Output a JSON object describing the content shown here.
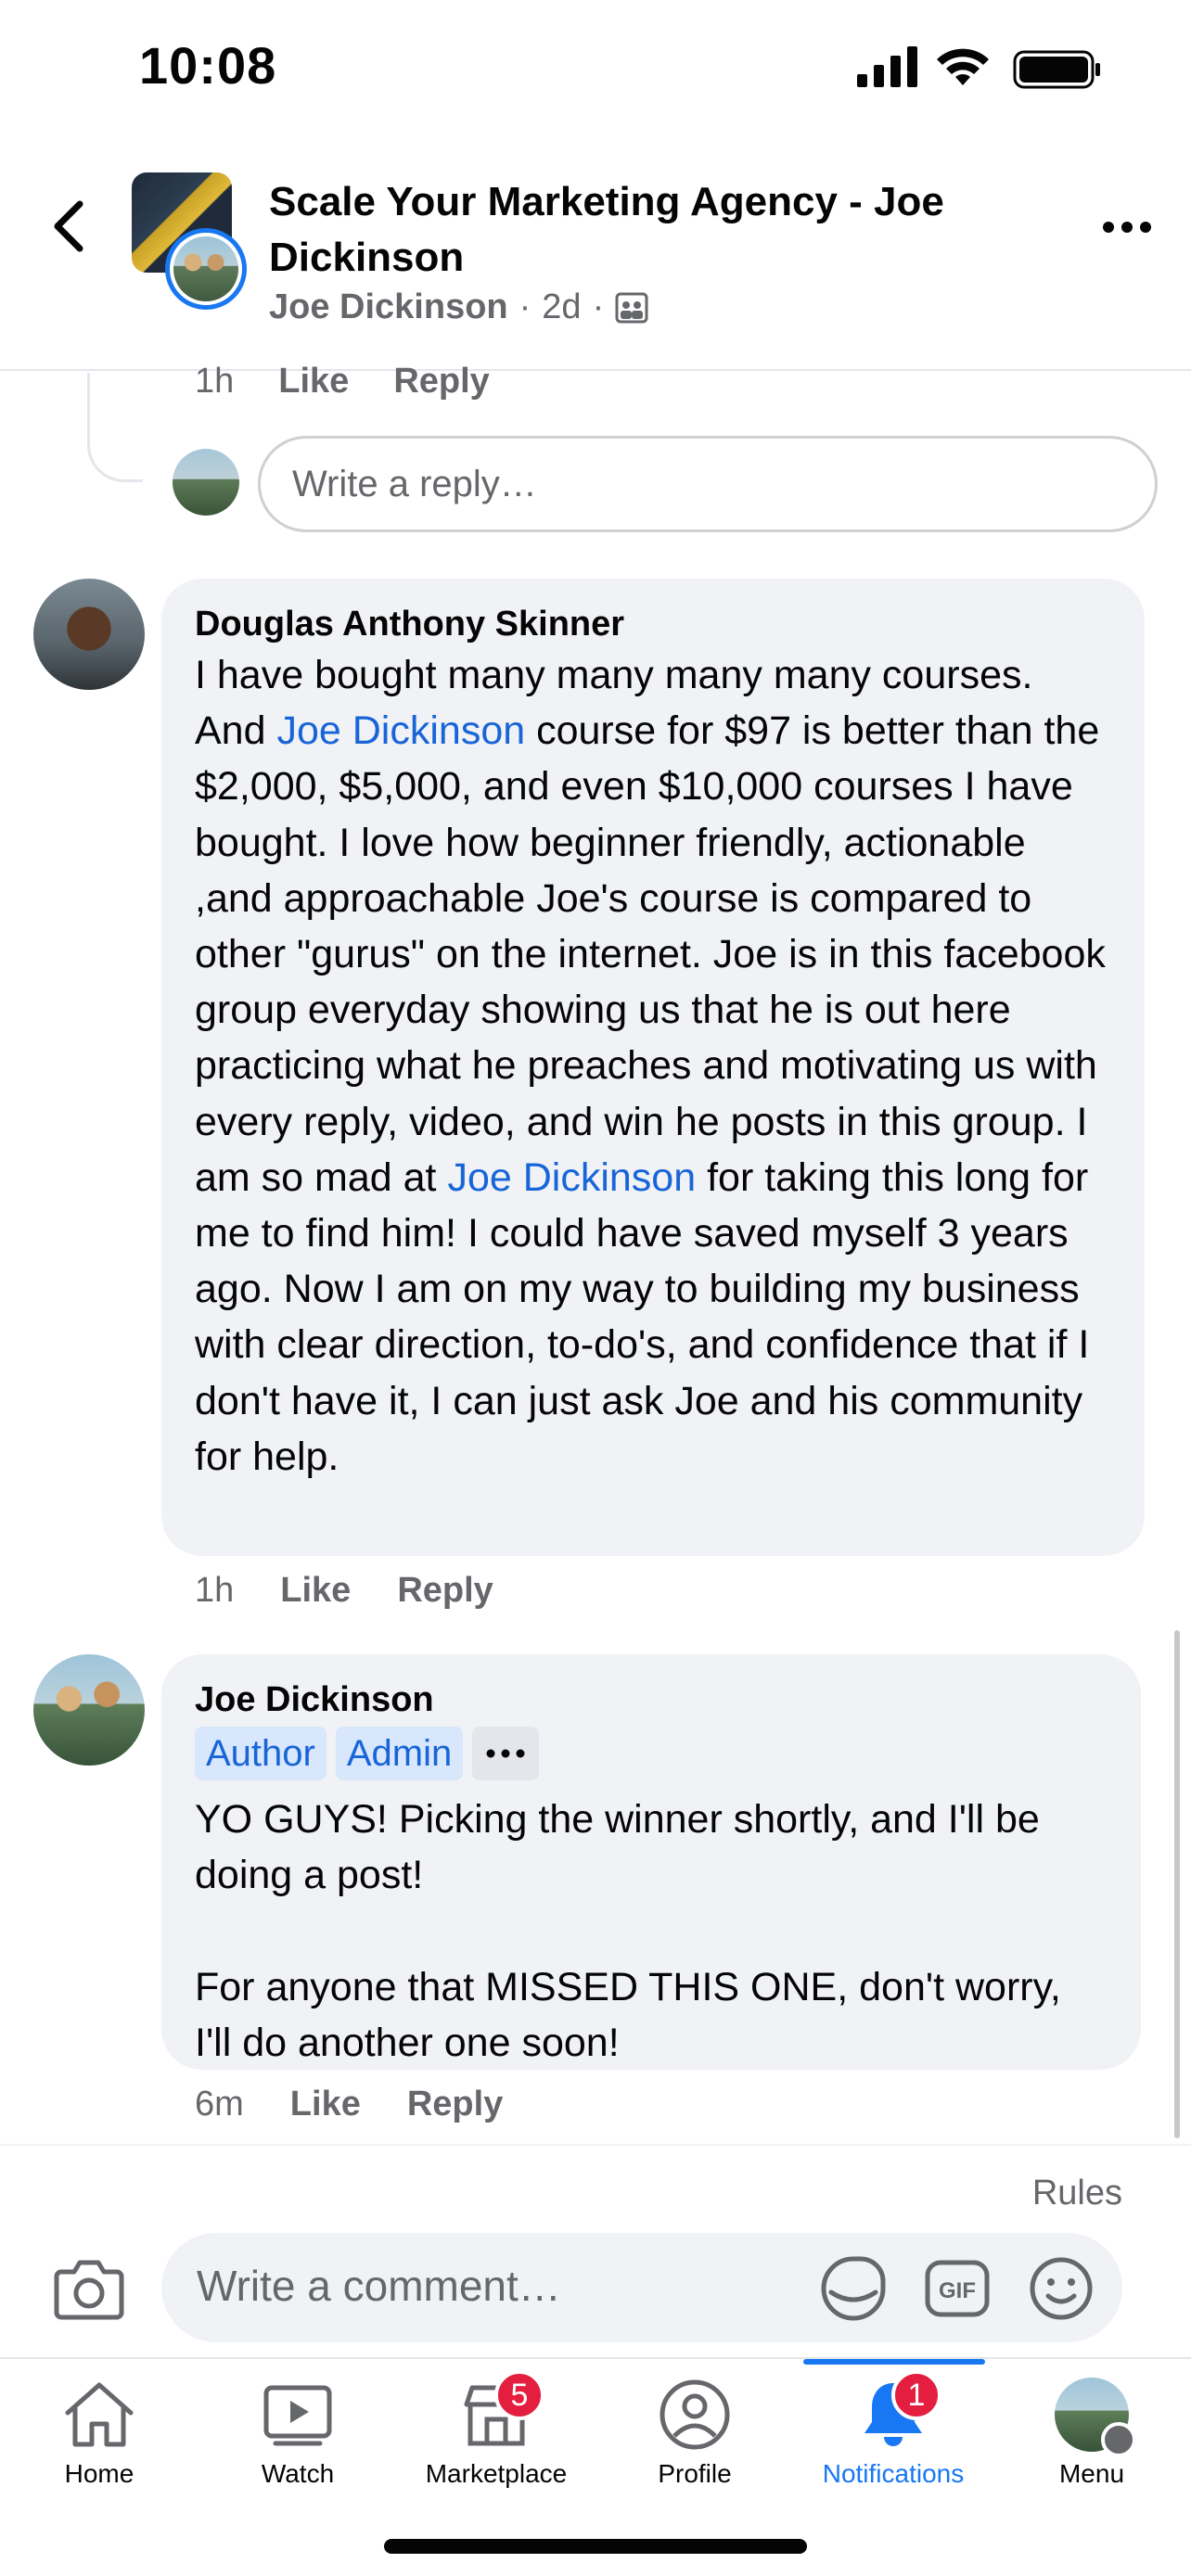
{
  "status_bar": {
    "time": "10:08"
  },
  "header": {
    "title": "Scale Your Marketing Agency - Joe Dickinson",
    "author": "Joe Dickinson",
    "time": "2d",
    "separator": "·"
  },
  "previous_comment_meta": {
    "time": "1h",
    "like": "Like",
    "reply": "Reply"
  },
  "reply_box": {
    "placeholder": "Write a reply…"
  },
  "comments": [
    {
      "author": "Douglas Anthony Skinner",
      "text_parts": [
        "I have bought many many many many courses. And ",
        "Joe Dickinson",
        " course for $97 is better than the $2,000, $5,000, and even $10,000 courses I have bought. I love how beginner friendly, actionable ,and approachable Joe's course is compared to other \"gurus\" on the internet. Joe is in this facebook group everyday showing us that he is out here practicing what he preaches and motivating us with every reply, video, and win he posts in this group. I am so mad at ",
        "Joe Dickinson",
        " for taking this long for me to find him! I could have saved myself 3 years ago. Now I am on my way to building my business with clear direction, to-do's, and confidence that if I don't have it, I can just ask Joe and his community for help."
      ],
      "time": "1h",
      "like": "Like",
      "reply": "Reply"
    },
    {
      "author": "Joe Dickinson",
      "badges": [
        "Author",
        "Admin"
      ],
      "text": "YO GUYS! Picking the winner shortly, and I'll be doing a post!\n\nFor anyone that MISSED THIS ONE, don't worry, I'll do another one soon!",
      "time": "6m",
      "like": "Like",
      "reply": "Reply"
    }
  ],
  "composer": {
    "rules": "Rules",
    "placeholder": "Write a comment…",
    "icons": [
      "camera-icon",
      "sticker-icon",
      "gif-icon",
      "emoji-icon"
    ]
  },
  "tabbar": {
    "tabs": [
      {
        "label": "Home",
        "icon": "home-icon"
      },
      {
        "label": "Watch",
        "icon": "watch-icon"
      },
      {
        "label": "Marketplace",
        "icon": "marketplace-icon",
        "badge": "5"
      },
      {
        "label": "Profile",
        "icon": "profile-icon"
      },
      {
        "label": "Notifications",
        "icon": "bell-icon",
        "badge": "1",
        "active": true
      },
      {
        "label": "Menu",
        "icon": "menu-avatar"
      }
    ]
  },
  "colors": {
    "accent": "#1877f2",
    "mention": "#1865d8",
    "badge_red": "#e41e3f",
    "bubble": "#f0f2f5"
  }
}
